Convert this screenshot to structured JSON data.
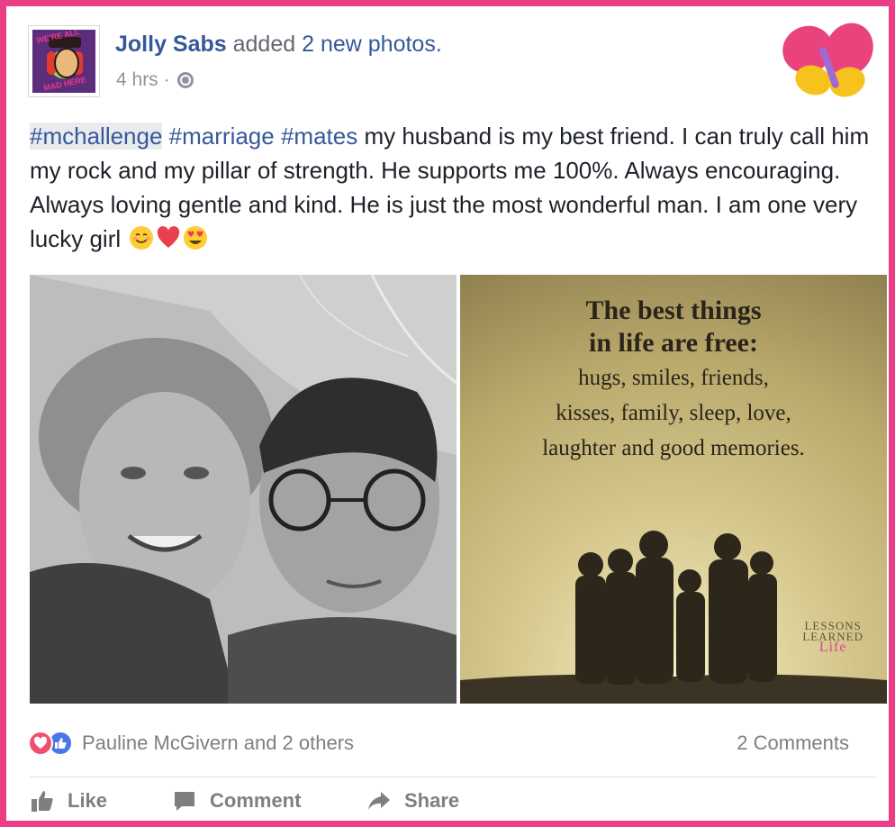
{
  "post": {
    "author": "Jolly Sabs",
    "action_text": "added",
    "photos_link": "2 new photos.",
    "time": "4 hrs",
    "separator": "·",
    "privacy_icon": "globe-icon",
    "decoration_icon": "butterfly-icon",
    "text": {
      "tag1": "#mchallenge",
      "tag2": "#marriage",
      "tag3": "#mates",
      "body": " my husband is my best friend. I can truly call him my rock and my pillar of strength. He supports me 100%. Always encouraging. Always loving gentle and kind. He is just the most wonderful man. I am one very lucky girl ",
      "emojis": [
        "smiling-face-emoji",
        "red-heart-emoji",
        "heart-eyes-emoji"
      ]
    },
    "avatar_text": {
      "top": "WE'RE ALL",
      "bottom": "MAD HERE"
    }
  },
  "photos": {
    "left": {
      "description_icon": "couple-selfie-photo"
    },
    "right": {
      "title": [
        "The best things",
        "in life are free:"
      ],
      "body": [
        "hugs, smiles, friends,",
        "kisses, family, sleep, love,",
        "laughter and good memories."
      ],
      "brand_line1": "LESSONS",
      "brand_line2": "LEARNED",
      "brand_line3": "Life"
    }
  },
  "reactions": {
    "names": "Pauline McGivern and 2 others",
    "comments": "2 Comments",
    "colors": {
      "love": "#f0506e",
      "like": "#4a77e6"
    }
  },
  "actions": {
    "like": "Like",
    "comment": "Comment",
    "share": "Share"
  },
  "colors": {
    "frame": "#ec3e86",
    "link": "#365899",
    "muted": "#7f7f7f"
  }
}
